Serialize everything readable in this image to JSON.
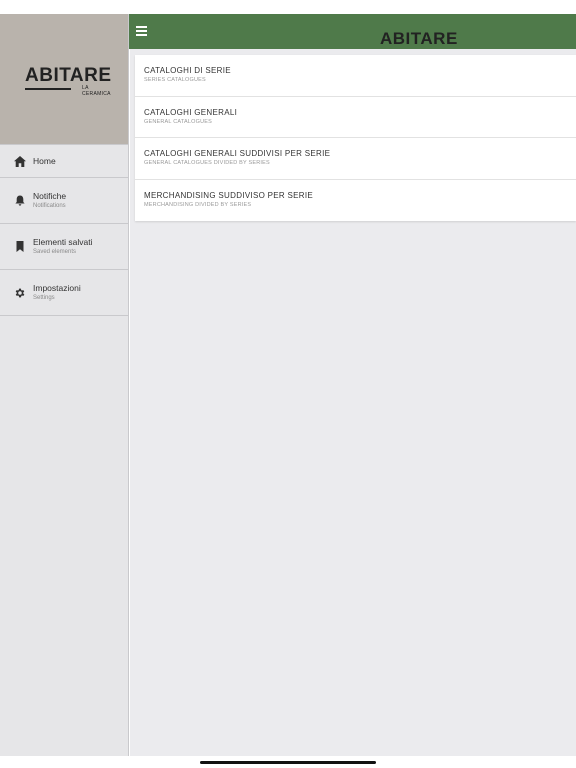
{
  "brand": {
    "name": "ABITARE",
    "tagline": "LA CERAMICA"
  },
  "colors": {
    "topbar": "#4f7a4a",
    "sidebar_header": "#b9b3ac",
    "sidebar_bg": "#e6e6e8"
  },
  "sidebar": {
    "items": [
      {
        "label": "Home",
        "sublabel": "",
        "icon": "home-icon"
      },
      {
        "label": "Notifiche",
        "sublabel": "Notifications",
        "icon": "bell-icon"
      },
      {
        "label": "Elementi salvati",
        "sublabel": "Saved elements",
        "icon": "bookmark-icon"
      },
      {
        "label": "Impostazioni",
        "sublabel": "Settings",
        "icon": "gear-icon"
      }
    ]
  },
  "topbar": {
    "menu_icon": "hamburger-menu-icon"
  },
  "catalog_list": [
    {
      "title": "CATALOGHI DI SERIE",
      "subtitle": "SERIES CATALOGUES"
    },
    {
      "title": "CATALOGHI GENERALI",
      "subtitle": "GENERAL CATALOGUES"
    },
    {
      "title": "CATALOGHI GENERALI SUDDIVISI PER SERIE",
      "subtitle": "GENERAL CATALOGUES DIVIDED BY SERIES"
    },
    {
      "title": "MERCHANDISING SUDDIVISO PER SERIE",
      "subtitle": "MERCHANDISING DIVIDED BY SERIES"
    }
  ]
}
